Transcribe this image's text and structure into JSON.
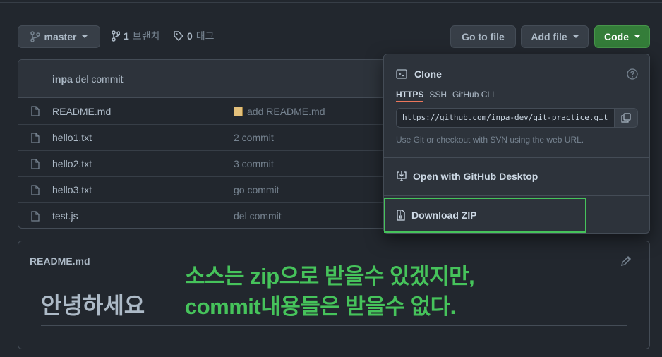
{
  "toolbar": {
    "branch_label": "master",
    "branches_count": "1",
    "branches_label": "브랜치",
    "tags_count": "0",
    "tags_label": "태그",
    "go_to_file": "Go to file",
    "add_file": "Add file",
    "code": "Code"
  },
  "commit_header": {
    "author": "inpa",
    "message": "del commit"
  },
  "files": [
    {
      "name": "README.md",
      "message": "add README.md"
    },
    {
      "name": "hello1.txt",
      "message": "2 commit"
    },
    {
      "name": "hello2.txt",
      "message": "3 commit"
    },
    {
      "name": "hello3.txt",
      "message": "go commit"
    },
    {
      "name": "test.js",
      "message": "del commit"
    }
  ],
  "readme": {
    "title": "README.md",
    "heading": "안녕하세요"
  },
  "annotation": {
    "line1": "소스는 zip으로 받을수 있겠지만,",
    "line2": "commit내용들은 받을수 없다."
  },
  "code_dropdown": {
    "clone_title": "Clone",
    "tabs": [
      "HTTPS",
      "SSH",
      "GitHub CLI"
    ],
    "active_tab": "HTTPS",
    "url": "https://github.com/inpa-dev/git-practice.git",
    "help_text": "Use Git or checkout with SVN using the web URL.",
    "open_desktop": "Open with GitHub Desktop",
    "download_zip": "Download ZIP"
  },
  "colors": {
    "background": "#22272e",
    "code_button": "#347d39",
    "annotation": "#46c35b",
    "tab_underline": "#ec775c"
  }
}
